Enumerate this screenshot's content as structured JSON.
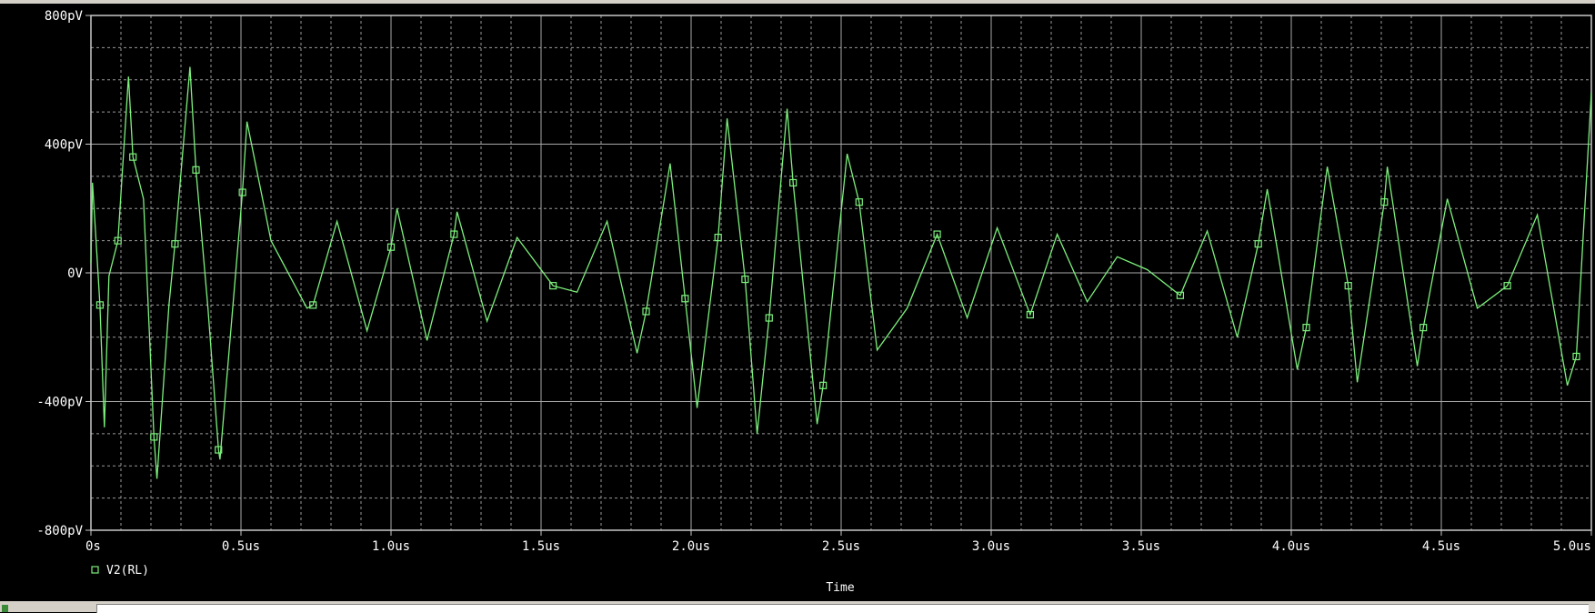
{
  "chart_data": {
    "type": "line",
    "xlabel": "Time",
    "ylabel": "",
    "xlim": [
      0,
      5.0
    ],
    "ylim": [
      -800,
      800
    ],
    "x_ticks": [
      "0s",
      "0.5us",
      "1.0us",
      "1.5us",
      "2.0us",
      "2.5us",
      "3.0us",
      "3.5us",
      "4.0us",
      "4.5us",
      "5.0us"
    ],
    "y_ticks": [
      "800pV",
      "400pV",
      "0V",
      "-400pV",
      "-800pV"
    ],
    "y_tick_values": [
      800,
      400,
      0,
      -400,
      -800
    ],
    "grid": true,
    "legend_position": "bottom-left",
    "colors": {
      "background": "#000000",
      "trace": "#7cf07c",
      "grid": "#9a9a9a",
      "axis_text": "#ffffff"
    },
    "series": [
      {
        "name": "V2(RL)",
        "marker": "hollow-square",
        "x": [
          0,
          0.005,
          0.015,
          0.03,
          0.045,
          0.06,
          0.09,
          0.125,
          0.14,
          0.175,
          0.21,
          0.22,
          0.26,
          0.28,
          0.33,
          0.35,
          0.39,
          0.425,
          0.43,
          0.505,
          0.52,
          0.6,
          0.72,
          0.74,
          0.82,
          0.92,
          1.0,
          1.02,
          1.12,
          1.21,
          1.22,
          1.32,
          1.42,
          1.54,
          1.62,
          1.72,
          1.82,
          1.85,
          1.93,
          1.98,
          2.02,
          2.09,
          2.12,
          2.18,
          2.22,
          2.26,
          2.32,
          2.34,
          2.42,
          2.44,
          2.52,
          2.56,
          2.62,
          2.72,
          2.82,
          2.92,
          3.02,
          3.13,
          3.22,
          3.32,
          3.42,
          3.52,
          3.63,
          3.72,
          3.82,
          3.89,
          3.92,
          4.02,
          4.05,
          4.12,
          4.19,
          4.22,
          4.31,
          4.32,
          4.42,
          4.44,
          4.52,
          4.62,
          4.72,
          4.82,
          4.92,
          4.95,
          5.0
        ],
        "y": [
          30,
          280,
          130,
          -100,
          -480,
          -10,
          100,
          610,
          360,
          230,
          -510,
          -640,
          -100,
          90,
          640,
          320,
          -110,
          -550,
          -580,
          250,
          470,
          100,
          -110,
          -100,
          160,
          -180,
          80,
          200,
          -210,
          120,
          190,
          -150,
          110,
          -40,
          -60,
          160,
          -250,
          -120,
          340,
          -80,
          -420,
          110,
          480,
          -20,
          -500,
          -140,
          510,
          280,
          -470,
          -350,
          370,
          220,
          -240,
          -110,
          120,
          -140,
          140,
          -130,
          120,
          -90,
          50,
          10,
          -70,
          130,
          -200,
          90,
          260,
          -300,
          -170,
          330,
          -40,
          -340,
          220,
          330,
          -290,
          -170,
          230,
          -110,
          -40,
          180,
          -350,
          -260,
          560
        ]
      }
    ]
  }
}
